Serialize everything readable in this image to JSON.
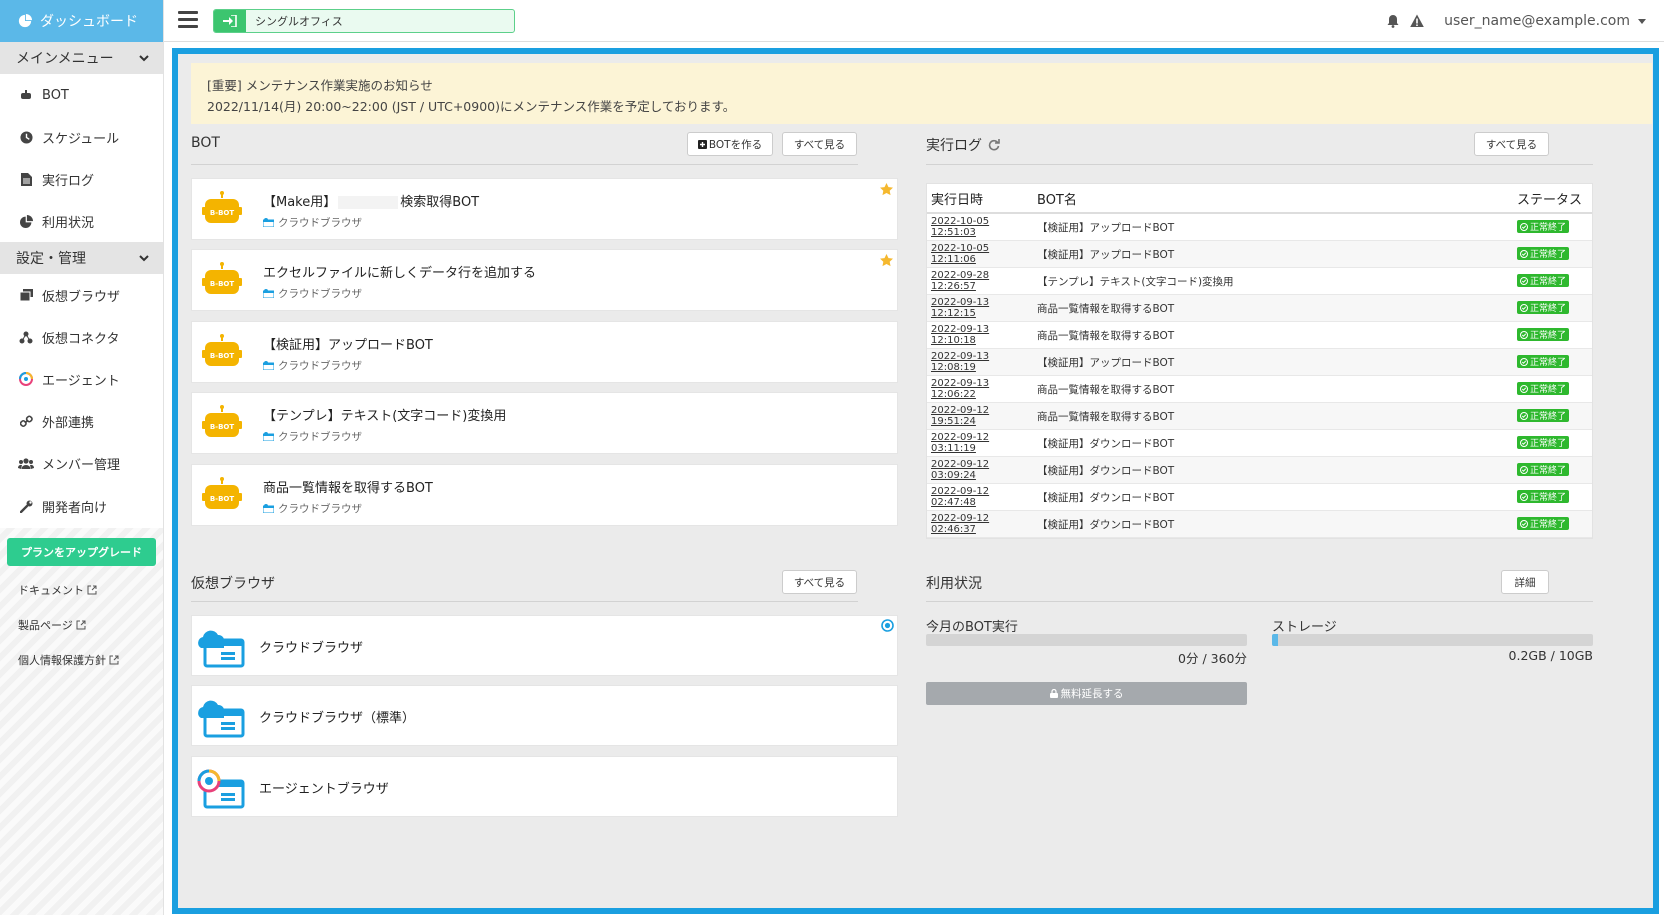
{
  "sidebar": {
    "dashboard": "ダッシュボード",
    "main_menu": "メインメニュー",
    "main_items": [
      "BOT",
      "スケジュール",
      "実行ログ",
      "利用状況"
    ],
    "settings_menu": "設定・管理",
    "settings_items": [
      "仮想ブラウザ",
      "仮想コネクタ",
      "エージェント",
      "外部連携",
      "メンバー管理",
      "開発者向け"
    ],
    "upgrade": "プランをアップグレード",
    "links": [
      "ドキュメント",
      "製品ページ",
      "個人情報保護方針"
    ]
  },
  "topbar": {
    "office": "シングルオフィス",
    "user": "user_name@example.com"
  },
  "notice": {
    "title": "[重要] メンテナンス作業実施のお知らせ",
    "body": "2022/11/14(月) 20:00~22:00 (JST / UTC+0900)にメンテナンス作業を予定しております。"
  },
  "bot_panel": {
    "title": "BOT",
    "create": "BOTを作る",
    "see_all": "すべて見る",
    "bots": [
      {
        "name_pre": "【Make用】",
        "name_post": "検索取得BOT",
        "type": "クラウドブラウザ",
        "starred": true
      },
      {
        "name": "エクセルファイルに新しくデータ行を追加する",
        "type": "クラウドブラウザ",
        "starred": true
      },
      {
        "name": "【検証用】アップロードBOT",
        "type": "クラウドブラウザ",
        "starred": false
      },
      {
        "name": "【テンプレ】テキスト(文字コード)変換用",
        "type": "クラウドブラウザ",
        "starred": false
      },
      {
        "name": "商品一覧情報を取得するBOT",
        "type": "クラウドブラウザ",
        "starred": false
      }
    ],
    "logo_text": "B-BOT"
  },
  "log_panel": {
    "title": "実行ログ",
    "see_all": "すべて見る",
    "headers": [
      "実行日時",
      "BOT名",
      "ステータス"
    ],
    "rows": [
      {
        "date": "2022-10-05 12:51:03",
        "bot": "【検証用】アップロードBOT",
        "status": "正常終了"
      },
      {
        "date": "2022-10-05 12:11:06",
        "bot": "【検証用】アップロードBOT",
        "status": "正常終了"
      },
      {
        "date": "2022-09-28 12:26:57",
        "bot": "【テンプレ】テキスト(文字コード)変換用",
        "status": "正常終了"
      },
      {
        "date": "2022-09-13 12:12:15",
        "bot": "商品一覧情報を取得するBOT",
        "status": "正常終了"
      },
      {
        "date": "2022-09-13 12:10:18",
        "bot": "商品一覧情報を取得するBOT",
        "status": "正常終了"
      },
      {
        "date": "2022-09-13 12:08:19",
        "bot": "【検証用】アップロードBOT",
        "status": "正常終了"
      },
      {
        "date": "2022-09-13 12:06:22",
        "bot": "商品一覧情報を取得するBOT",
        "status": "正常終了"
      },
      {
        "date": "2022-09-12 19:51:24",
        "bot": "商品一覧情報を取得するBOT",
        "status": "正常終了"
      },
      {
        "date": "2022-09-12 03:11:19",
        "bot": "【検証用】ダウンロードBOT",
        "status": "正常終了"
      },
      {
        "date": "2022-09-12 03:09:24",
        "bot": "【検証用】ダウンロードBOT",
        "status": "正常終了"
      },
      {
        "date": "2022-09-12 02:47:48",
        "bot": "【検証用】ダウンロードBOT",
        "status": "正常終了"
      },
      {
        "date": "2022-09-12 02:46:37",
        "bot": "【検証用】ダウンロードBOT",
        "status": "正常終了"
      }
    ]
  },
  "vb_panel": {
    "title": "仮想ブラウザ",
    "see_all": "すべて見る",
    "items": [
      "クラウドブラウザ",
      "クラウドブラウザ（標準）",
      "エージェントブラウザ"
    ]
  },
  "usage_panel": {
    "title": "利用状況",
    "detail": "詳細",
    "bot_exec_label": "今月のBOT実行",
    "bot_exec_value": "0分 / 360分",
    "bot_exec_fraction": 0,
    "storage_label": "ストレージ",
    "storage_value": "0.2GB / 10GB",
    "storage_fraction": 0.02,
    "extend": "無料延長する"
  },
  "colors": {
    "accent": "#1a9fe0",
    "sidebar_active": "#5bb8e8",
    "success": "#2eb82e",
    "upgrade": "#2ecc8f",
    "star": "#f5b82e"
  }
}
